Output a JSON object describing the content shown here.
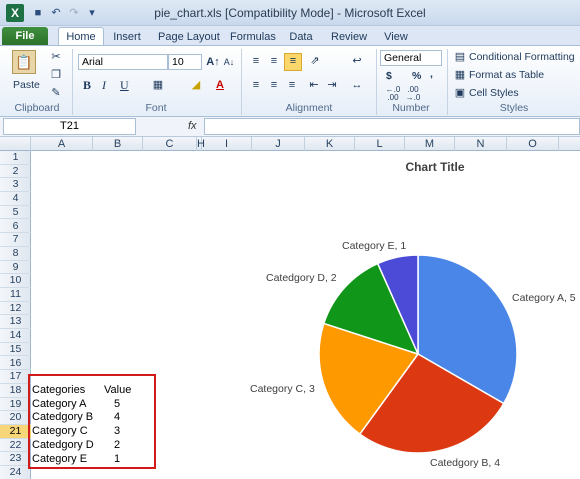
{
  "window": {
    "title": "pie_chart.xls  [Compatibility Mode]  -  Microsoft Excel"
  },
  "tabs": [
    {
      "label": "File"
    },
    {
      "label": "Home"
    },
    {
      "label": "Insert"
    },
    {
      "label": "Page Layout"
    },
    {
      "label": "Formulas"
    },
    {
      "label": "Data"
    },
    {
      "label": "Review"
    },
    {
      "label": "View"
    }
  ],
  "ribbon": {
    "clipboard": {
      "label": "Clipboard",
      "paste": "Paste"
    },
    "font": {
      "label": "Font",
      "family": "Arial",
      "size": "10",
      "bold": "B",
      "italic": "I",
      "underline": "U"
    },
    "alignment": {
      "label": "Alignment"
    },
    "number": {
      "label": "Number",
      "format": "General",
      "currency": "$",
      "percent": "%",
      "comma": ","
    },
    "styles": {
      "label": "Styles",
      "conditional": "Conditional Formatting",
      "table": "Format as Table",
      "cell_styles": "Cell Styles"
    }
  },
  "formula_bar": {
    "name_box": "T21",
    "fx": "fx",
    "value": ""
  },
  "columns": [
    "A",
    "B",
    "C",
    "H",
    "I",
    "J",
    "K",
    "L",
    "M",
    "N",
    "O"
  ],
  "rows": [
    "1",
    "2",
    "3",
    "4",
    "5",
    "6",
    "7",
    "8",
    "9",
    "10",
    "11",
    "12",
    "13",
    "14",
    "15",
    "16",
    "17",
    "18",
    "19",
    "20",
    "21",
    "22",
    "23",
    "24"
  ],
  "selected_row": "21",
  "sheet": {
    "header": {
      "category": "Categories",
      "value": "Value"
    },
    "rows": [
      {
        "category": "Category A",
        "value": "5"
      },
      {
        "category": "Catedgory B",
        "value": "4"
      },
      {
        "category": "Category C",
        "value": "3"
      },
      {
        "category": "Catedgory D",
        "value": "2"
      },
      {
        "category": "Category E",
        "value": "1"
      }
    ]
  },
  "chart_data": {
    "type": "pie",
    "title": "Chart Title",
    "categories": [
      "Category A",
      "Catedgory B",
      "Category C",
      "Catedgory D",
      "Category E"
    ],
    "values": [
      5,
      4,
      3,
      2,
      1
    ],
    "labels": [
      "Category A, 5",
      "Catedgory B, 4",
      "Category C, 3",
      "Catedgory D, 2",
      "Category E, 1"
    ],
    "colors": [
      "#4a86e8",
      "#dc3912",
      "#ff9900",
      "#109618",
      "#4b4bd8"
    ],
    "legend": "none"
  },
  "colors": {
    "file_tab": "#2a6f2a",
    "highlight_box": "#d11a1a",
    "selected_row": "#f7d67a"
  }
}
